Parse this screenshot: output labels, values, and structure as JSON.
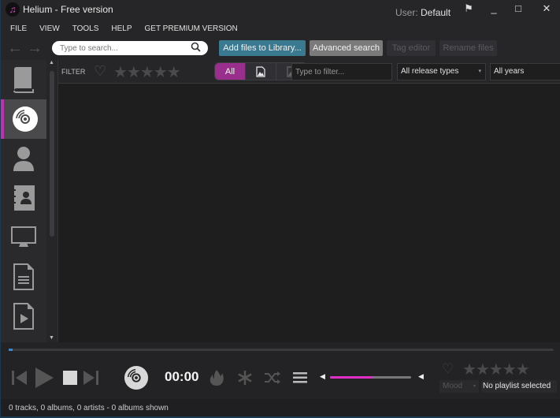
{
  "window": {
    "title": "Helium - Free version",
    "logo_glyph": "♫",
    "user_label": "User:",
    "user_name": "Default",
    "flag_glyph": "⚑",
    "minimize_glyph": "_",
    "maximize_glyph": "□",
    "close_glyph": "✕"
  },
  "menu": [
    "FILE",
    "VIEW",
    "TOOLS",
    "HELP",
    "GET PREMIUM VERSION"
  ],
  "toolbar": {
    "back_glyph": "←",
    "forward_glyph": "→",
    "search_placeholder": "Type to search...",
    "search_value": "",
    "add_files_label": "Add files to Library...",
    "advanced_search_label": "Advanced search",
    "tag_editor_label": "Tag editor",
    "rename_files_label": "Rename files"
  },
  "sidebar": {
    "items": [
      {
        "name": "library",
        "icon": "book-icon",
        "active": false
      },
      {
        "name": "albums",
        "icon": "disc-icon",
        "active": true
      },
      {
        "name": "artists",
        "icon": "person-icon",
        "active": false
      },
      {
        "name": "contacts",
        "icon": "contact-book-icon",
        "active": false
      },
      {
        "name": "devices",
        "icon": "monitor-icon",
        "active": false
      },
      {
        "name": "playlists",
        "icon": "document-icon",
        "active": false
      },
      {
        "name": "videos",
        "icon": "video-file-icon",
        "active": false
      }
    ]
  },
  "filter": {
    "label": "FILTER",
    "heart_glyph": "♡",
    "stars": "★★★★★",
    "rating": 0,
    "segments": [
      {
        "label": "All",
        "active": true
      },
      {
        "label": "",
        "icon": "image-file-icon",
        "active": false
      },
      {
        "label": "",
        "icon": "image-file-dim-icon",
        "active": false
      }
    ],
    "filter_placeholder": "Type to filter...",
    "release_types": "All release types",
    "years": "All years",
    "caret_glyph": "▾"
  },
  "player": {
    "progress": 0,
    "time": "00:00",
    "volume_percent": 52,
    "heart_glyph": "♡",
    "stars": "★★★★★",
    "rating": 0,
    "mood_label": "Mood",
    "playlist_label": "No playlist selected",
    "caret_glyph": "▾",
    "vol_low_glyph": "◀",
    "vol_high_glyph": "◀"
  },
  "status": {
    "text": "0 tracks, 0 albums, 0 artists - 0 albums shown"
  },
  "colors": {
    "accent": "#c030b0",
    "segment_active": "#9a2e8c",
    "add_button": "#3a7a90",
    "progress": "#2e8ae0",
    "volume": "#e030c8"
  }
}
